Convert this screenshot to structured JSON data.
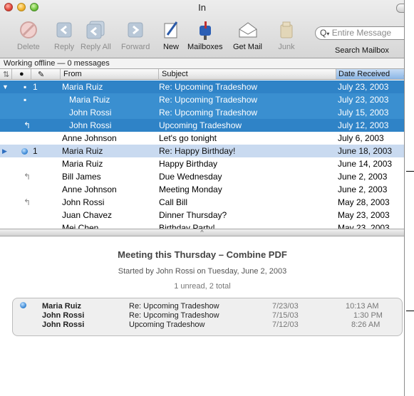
{
  "window": {
    "title": "In"
  },
  "toolbar": {
    "delete": "Delete",
    "reply": "Reply",
    "reply_all": "Reply All",
    "forward": "Forward",
    "new": "New",
    "mailboxes": "Mailboxes",
    "get_mail": "Get Mail",
    "junk": "Junk",
    "search_placeholder": "Entire Message",
    "search_label": "Search Mailbox"
  },
  "status": "Working offline — 0 messages",
  "columns": {
    "from": "From",
    "subject": "Subject",
    "date": "Date Received"
  },
  "rows": [
    {
      "count": "1",
      "from": "Maria Ruiz",
      "subject": "Re: Upcoming Tradeshow",
      "date": "July 23, 2003"
    },
    {
      "from": "Maria Ruiz",
      "subject": "Re: Upcoming Tradeshow",
      "date": "July 23, 2003"
    },
    {
      "from": "John Rossi",
      "subject": "Re: Upcoming Tradeshow",
      "date": "July 15, 2003"
    },
    {
      "from": "John Rossi",
      "subject": "Upcoming Tradeshow",
      "date": "July 12, 2003"
    },
    {
      "from": "Anne Johnson",
      "subject": "Let's go tonight",
      "date": "July 6, 2003"
    },
    {
      "count": "1",
      "from": "Maria Ruiz",
      "subject": "Re: Happy Birthday!",
      "date": "June 18, 2003"
    },
    {
      "from": "Maria Ruiz",
      "subject": "Happy Birthday",
      "date": "June 14, 2003"
    },
    {
      "from": "Bill James",
      "subject": "Due Wednesday",
      "date": "June 2, 2003"
    },
    {
      "from": "Anne Johnson",
      "subject": "Meeting Monday",
      "date": "June 2, 2003"
    },
    {
      "from": "John Rossi",
      "subject": "Call Bill",
      "date": "May 28, 2003"
    },
    {
      "from": "Juan Chavez",
      "subject": "Dinner Thursday?",
      "date": "May 23, 2003"
    },
    {
      "from": "Mei Chen",
      "subject": "Birthday Party!",
      "date": "May 23, 2003"
    }
  ],
  "preview": {
    "title": "Meeting this Thursday – Combine PDF",
    "subtitle": "Started by John Rossi on Tuesday, June 2, 2003",
    "count": "1 unread, 2 total",
    "messages": [
      {
        "from": "Maria Ruiz",
        "subject": "Re: Upcoming Tradeshow",
        "date": "7/23/03",
        "time": "10:13 AM"
      },
      {
        "from": "John Rossi",
        "subject": "Re: Upcoming Tradeshow",
        "date": "7/15/03",
        "time": "1:30 PM"
      },
      {
        "from": "John Rossi",
        "subject": "Upcoming Tradeshow",
        "date": "7/12/03",
        "time": "8:26 AM"
      }
    ]
  }
}
